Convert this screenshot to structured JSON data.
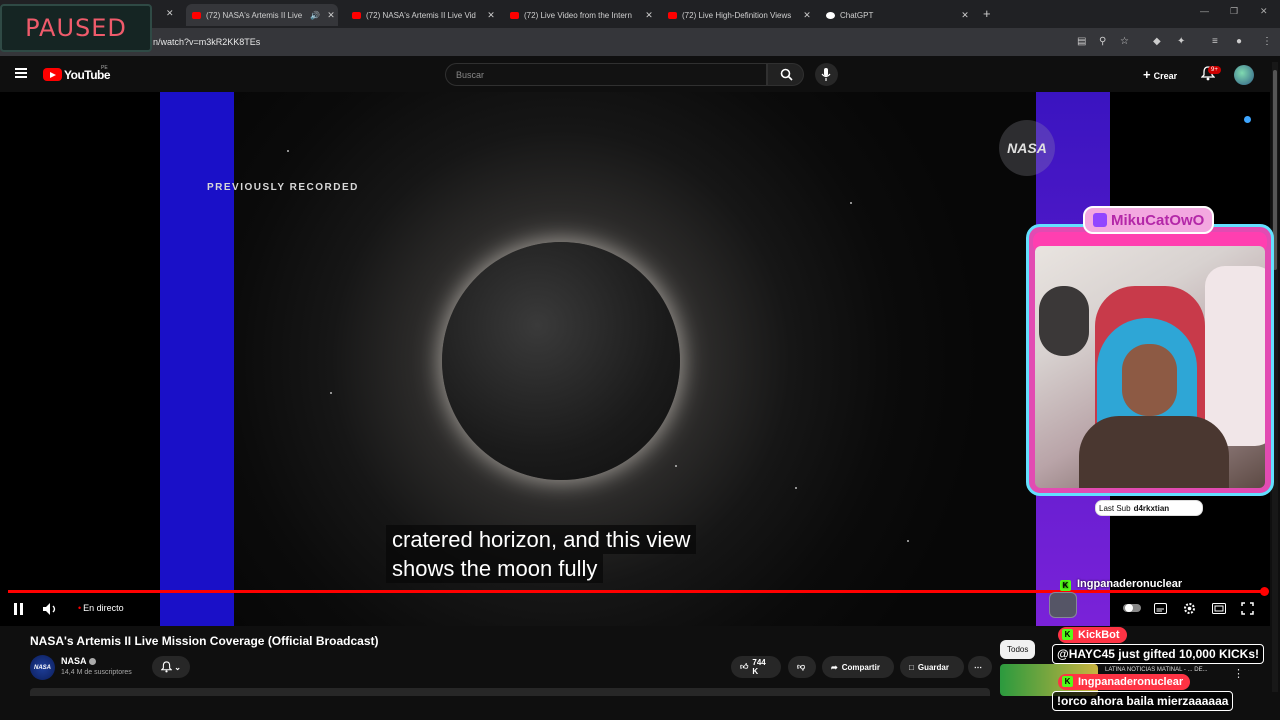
{
  "browser": {
    "tabs": [
      {
        "title": "(72) NASA's Artemis II Live",
        "active": true,
        "audio": true
      },
      {
        "title": "(72) NASA's Artemis II Live Vid"
      },
      {
        "title": "(72) Live Video from the Intern"
      },
      {
        "title": "(72) Live High-Definition Views"
      },
      {
        "title": "ChatGPT"
      }
    ],
    "url": "n/watch?v=m3kR2KK8TEs"
  },
  "overlay_paused": "PAUSED",
  "youtube": {
    "logo_text": "YouTube",
    "country": "PE",
    "search_placeholder": "Buscar",
    "create_label": "Crear",
    "notif_badge": "9+"
  },
  "video": {
    "previously_recorded": "PREVIOUSLY RECORDED",
    "nasa_logo": "NASA",
    "subtitle_line1": "cratered horizon, and this view",
    "subtitle_line2": "shows the moon fully",
    "live_label": "En directo"
  },
  "info": {
    "title": "NASA's Artemis II Live Mission Coverage (Official Broadcast)",
    "channel": "NASA",
    "channel_avatar": "NASA",
    "subscribers": "14,4 M de suscriptores",
    "likes": "744 K",
    "share": "Compartir",
    "save": "Guardar"
  },
  "stream_overlay": {
    "streamer_name": "MikuCatOwO",
    "last_sub_label": "Last Sub",
    "last_sub_name": "d4rkxtian",
    "chat": [
      {
        "user": "Ingpanaderonuclear"
      },
      {
        "user": "KickBot",
        "message": "@HAYC45 just gifted 10,000 KICKs!"
      },
      {
        "user": "Ingpanaderonuclear",
        "message": "!orco ahora baila mierzaaaaaa"
      }
    ],
    "kick_badge": "K"
  },
  "sidebar": {
    "chip_all": "Todos",
    "related_title": "LATINA NOTICIAS MATINAL - ... DE..."
  },
  "colors": {
    "accent_red": "#ff0000",
    "overlay_pink": "#ff3fb0",
    "overlay_cyan": "#63e0ff",
    "kick_green": "#53fc18"
  }
}
